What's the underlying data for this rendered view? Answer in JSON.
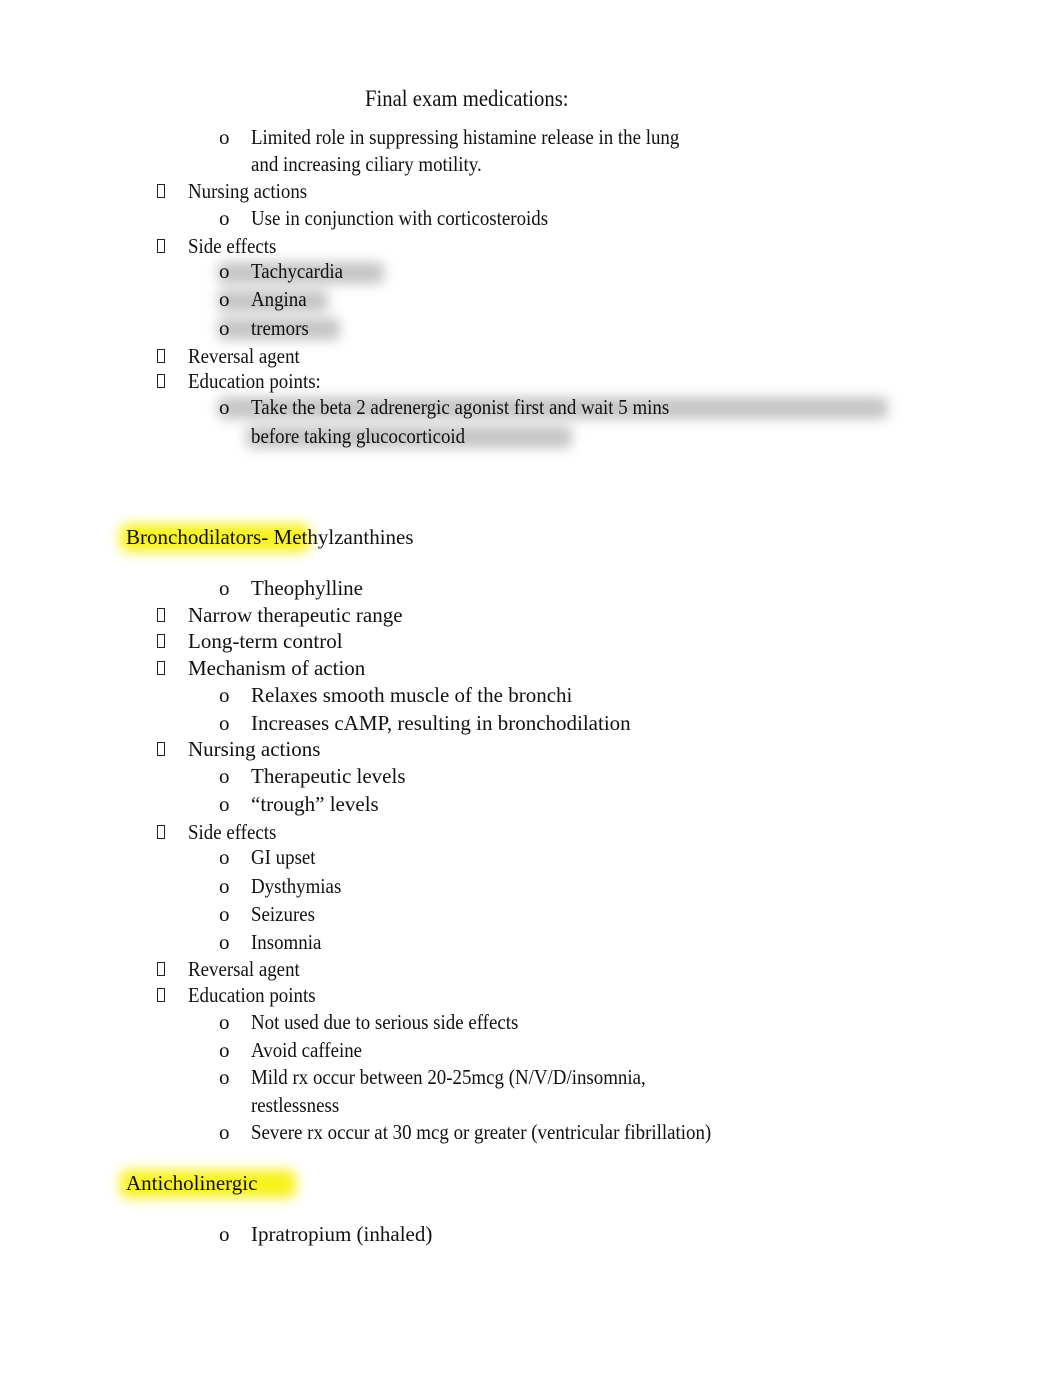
{
  "document": {
    "title": "Final exam medications:",
    "section1": {
      "intro_lines": [
        "Limited role in suppressing histamine release in the lung",
        "and increasing ciliary motility."
      ],
      "nursing_label": "Nursing actions",
      "nursing_items": [
        "Use in conjunction with corticosteroids"
      ],
      "side_label": "Side effects",
      "side_items": [
        "Tachycardia",
        "Angina",
        "tremors"
      ],
      "reversal_label": "Reversal agent",
      "education_label": "Education points:",
      "education_lines": [
        "Take the beta 2 adrenergic agonist first and wait 5 mins",
        "before taking glucocorticoid"
      ]
    },
    "section2": {
      "heading": "Bronchodilators- Methylzanthines",
      "drug": "Theophylline",
      "bullets": [
        "Narrow therapeutic range",
        "Long-term control",
        "Mechanism of action"
      ],
      "moa_items": [
        "Relaxes smooth muscle of the bronchi",
        "Increases cAMP, resulting in bronchodilation"
      ],
      "nursing_label": "Nursing actions",
      "nursing_items": [
        "Therapeutic levels",
        "“trough” levels"
      ],
      "side_label": "Side effects",
      "side_items": [
        "GI upset",
        "Dysthymias",
        "Seizures",
        "Insomnia"
      ],
      "reversal_label": "Reversal agent",
      "education_label": "Education points",
      "education_items": [
        "Not used due to serious side effects",
        "Avoid caffeine",
        "Mild rx occur between 20-25mcg (N/V/D/insomnia,",
        "restlessness",
        "Severe rx occur at 30 mcg or greater (ventricular fibrillation)"
      ]
    },
    "section3": {
      "heading": "Anticholinergic",
      "drug": "Ipratropium (inhaled)"
    },
    "glyphs": {
      "sub_bullet": "o"
    },
    "colors": {
      "highlight_yellow": "#f7f21a",
      "highlight_gray": "#969696"
    }
  }
}
